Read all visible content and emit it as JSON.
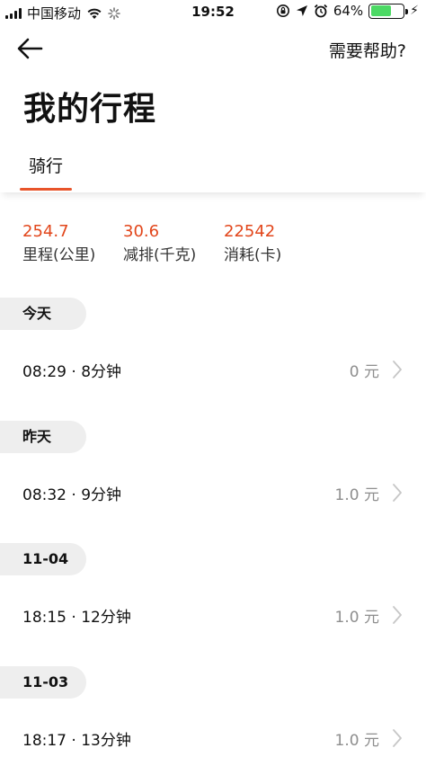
{
  "status_bar": {
    "carrier": "中国移动",
    "time": "19:52",
    "battery": "64%",
    "battery_level": 0.64
  },
  "nav": {
    "help_label": "需要帮助?"
  },
  "page": {
    "title": "我的行程"
  },
  "tabs": [
    {
      "label": "骑行",
      "active": true
    }
  ],
  "stats": [
    {
      "value": "254.7",
      "label": "里程(公里)"
    },
    {
      "value": "30.6",
      "label": "减排(千克)"
    },
    {
      "value": "22542",
      "label": "消耗(卡)"
    }
  ],
  "trips": [
    {
      "day": "今天",
      "time": "08:29 · 8分钟",
      "price": "0 元"
    },
    {
      "day": "昨天",
      "time": "08:32 · 9分钟",
      "price": "1.0 元"
    },
    {
      "day": "11-04",
      "time": "18:15 · 12分钟",
      "price": "1.0 元"
    },
    {
      "day": "11-03",
      "time": "18:17 · 13分钟",
      "price": "1.0 元"
    }
  ],
  "colors": {
    "accent": "#e8542a",
    "stat_value": "#e2461b",
    "price_gray": "#8e8e8e",
    "chip_bg": "#eeeeee",
    "battery_green": "#4cd964"
  }
}
